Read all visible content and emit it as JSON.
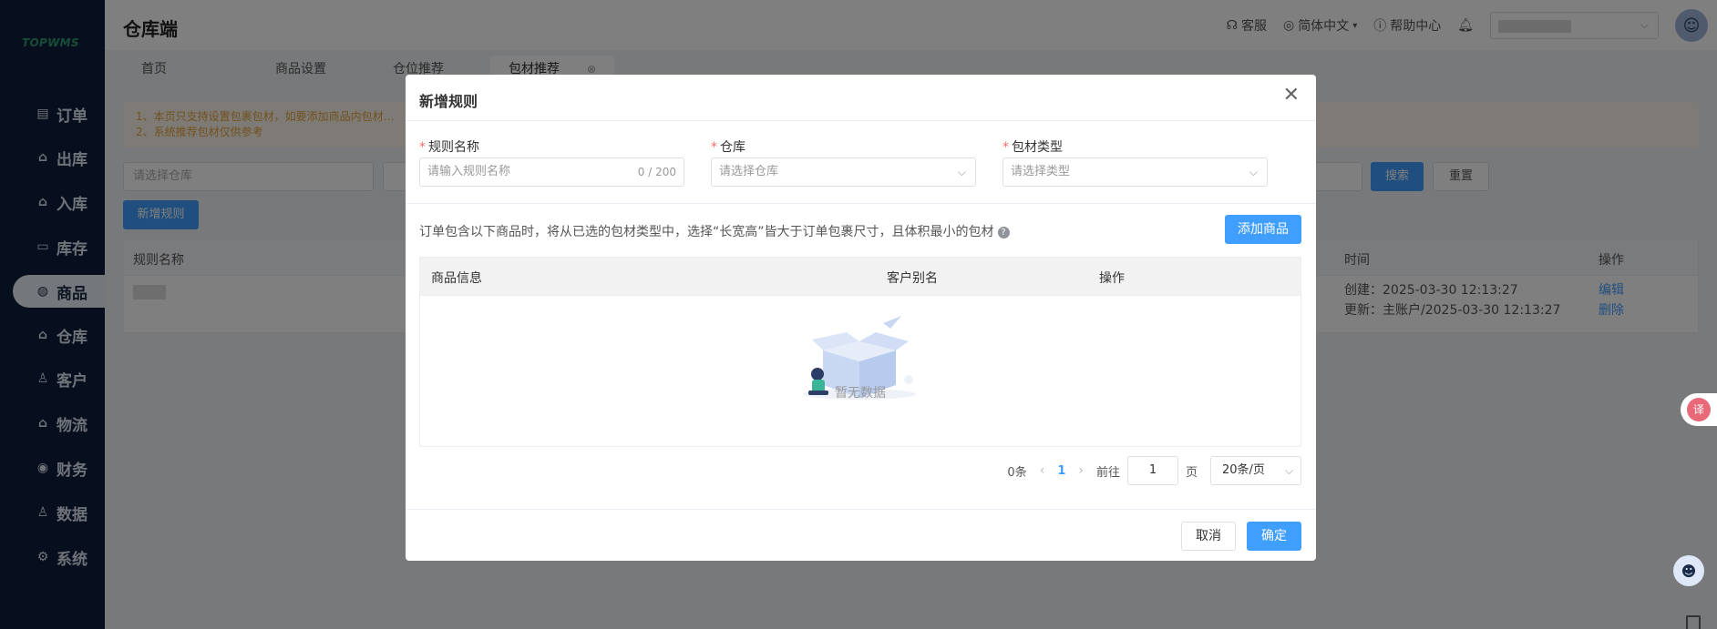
{
  "sidebar": {
    "logo": "TOPWMS",
    "items": [
      {
        "label": "订单",
        "icon": "list-icon",
        "glyph": "▤"
      },
      {
        "label": "出库",
        "icon": "outbound-icon",
        "glyph": "⌂"
      },
      {
        "label": "入库",
        "icon": "inbound-icon",
        "glyph": "⌂"
      },
      {
        "label": "库存",
        "icon": "inventory-icon",
        "glyph": "▭"
      },
      {
        "label": "商品",
        "icon": "product-icon",
        "glyph": "◍"
      },
      {
        "label": "仓库",
        "icon": "warehouse-icon",
        "glyph": "⌂"
      },
      {
        "label": "客户",
        "icon": "customer-icon",
        "glyph": "♙"
      },
      {
        "label": "物流",
        "icon": "logistics-icon",
        "glyph": "⌂"
      },
      {
        "label": "财务",
        "icon": "finance-icon",
        "glyph": "◉"
      },
      {
        "label": "数据",
        "icon": "data-icon",
        "glyph": "♙"
      },
      {
        "label": "系统",
        "icon": "settings-icon",
        "glyph": "⚙"
      }
    ],
    "active_index": 4
  },
  "header": {
    "title": "仓库端",
    "service": "客服",
    "language": "简体中文",
    "help": "帮助中心"
  },
  "tabs": [
    {
      "label": "首页"
    },
    {
      "label": "商品设置"
    },
    {
      "label": "仓位推荐"
    },
    {
      "label": "包材推荐"
    }
  ],
  "background": {
    "notice_line1": "1、本页只支持设置包裹包材，如要添加商品内包材…",
    "notice_line2": "2、系统推荐包材仅供参考",
    "warehouse_placeholder": "请选择仓库",
    "search_label": "搜索",
    "reset_label": "重置",
    "add_rule_label": "新增规则",
    "col_rule_name": "规则名称",
    "col_time": "时间",
    "col_action": "操作",
    "row_created": "创建：2025-03-30 12:13:27",
    "row_updated": "更新：主账户/2025-03-30 12:13:27",
    "row_edit": "编辑",
    "row_delete": "删除"
  },
  "modal": {
    "title": "新增规则",
    "fields": {
      "rule_name_label": "规则名称",
      "rule_name_placeholder": "请输入规则名称",
      "rule_name_counter": "0 / 200",
      "warehouse_label": "仓库",
      "warehouse_placeholder": "请选择仓库",
      "package_type_label": "包材类型",
      "package_type_placeholder": "请选择类型"
    },
    "description": "订单包含以下商品时，将从已选的包材类型中，选择“长宽高”皆大于订单包裹尺寸，且体积最小的包材",
    "add_product_label": "添加商品",
    "table": {
      "col_product": "商品信息",
      "col_alias": "客户别名",
      "col_action": "操作",
      "empty_text": "暂无数据"
    },
    "pagination": {
      "total": "0条",
      "current_page": "1",
      "goto_label": "前往",
      "goto_value": "1",
      "page_label": "页",
      "page_size": "20条/页"
    },
    "cancel_label": "取消",
    "ok_label": "确定"
  },
  "floating": {
    "translate_text": "译"
  }
}
